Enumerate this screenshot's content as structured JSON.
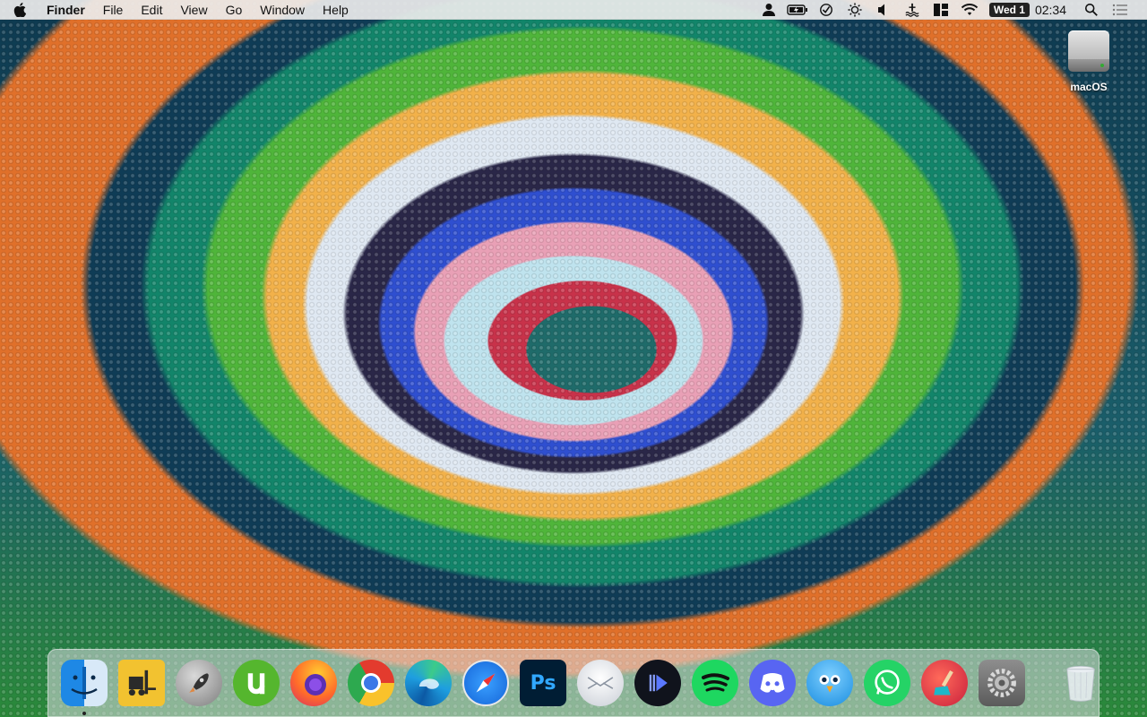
{
  "menubar": {
    "app_name": "Finder",
    "menus": [
      "File",
      "Edit",
      "View",
      "Go",
      "Window",
      "Help"
    ],
    "date": "Wed 1",
    "time": "02:34",
    "status_icons": [
      "user-icon",
      "battery-charging-icon",
      "checkmark-circle-icon",
      "brightness-icon",
      "volume-icon",
      "flood-icon",
      "window-layout-icon",
      "wifi-icon"
    ],
    "utility_icons": [
      "search-icon",
      "notification-center-icon"
    ]
  },
  "desktop": {
    "items": [
      {
        "label": "macOS",
        "icon": "hard-drive-icon"
      }
    ]
  },
  "dock": {
    "apps": [
      {
        "name": "Finder",
        "icon": "finder-icon",
        "running": true
      },
      {
        "name": "Forklift",
        "icon": "forklift-icon",
        "running": false
      },
      {
        "name": "Launchpad",
        "icon": "rocket-icon",
        "running": false
      },
      {
        "name": "uTorrent",
        "icon": "utorrent-icon",
        "running": false
      },
      {
        "name": "Firefox",
        "icon": "firefox-icon",
        "running": false
      },
      {
        "name": "Chrome",
        "icon": "chrome-icon",
        "running": false
      },
      {
        "name": "Edge",
        "icon": "edge-icon",
        "running": false
      },
      {
        "name": "Safari",
        "icon": "safari-icon",
        "running": false
      },
      {
        "name": "Photoshop",
        "icon": "photoshop-icon",
        "running": false
      },
      {
        "name": "Mail",
        "icon": "mail-icon",
        "running": false
      },
      {
        "name": "Infuse",
        "icon": "infuse-icon",
        "running": false
      },
      {
        "name": "Spotify",
        "icon": "spotify-icon",
        "running": false
      },
      {
        "name": "Discord",
        "icon": "discord-icon",
        "running": false
      },
      {
        "name": "Tweetbot",
        "icon": "tweetbot-icon",
        "running": false
      },
      {
        "name": "WhatsApp",
        "icon": "whatsapp-icon",
        "running": false
      },
      {
        "name": "CleanMyMac",
        "icon": "cleanmymac-icon",
        "running": false
      },
      {
        "name": "System Preferences",
        "icon": "system-preferences-icon",
        "running": false
      }
    ],
    "trash": {
      "name": "Trash",
      "icon": "trash-icon"
    },
    "ps_label": "Ps"
  },
  "colors": {
    "menubar_bg": "#ececec",
    "date_badge_bg": "#222222"
  }
}
